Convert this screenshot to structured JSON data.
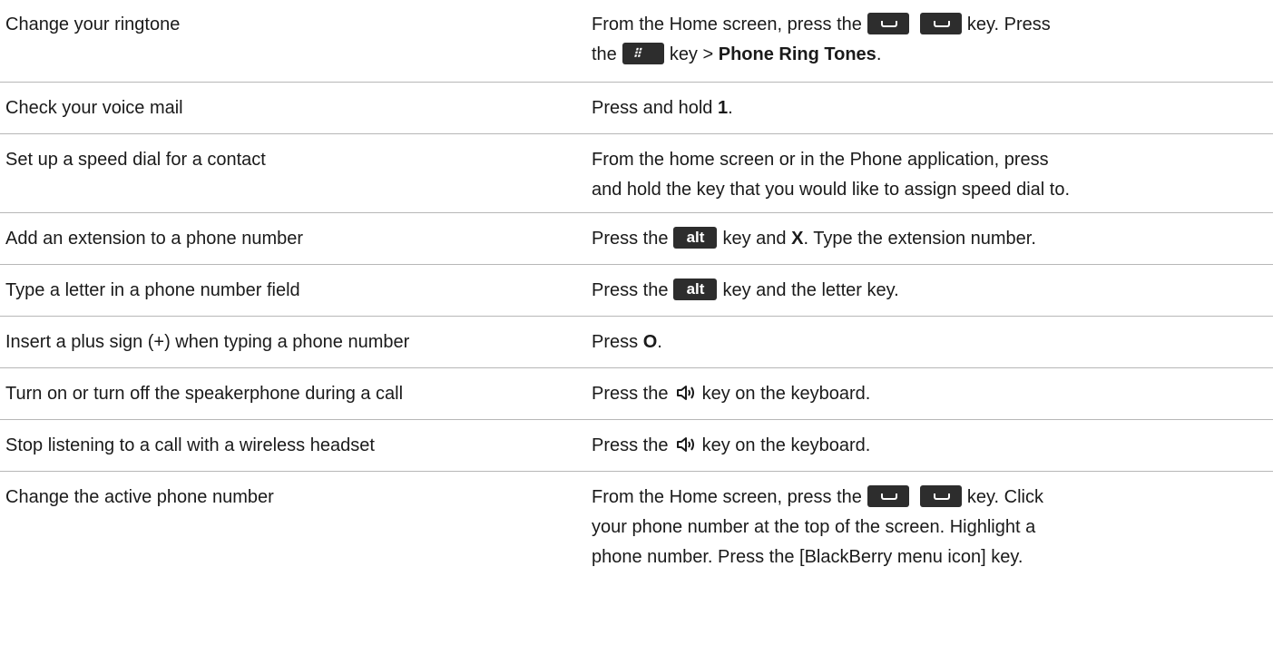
{
  "rows": [
    {
      "task": "Change your ringtone",
      "line1": {
        "a": "From the Home screen, press the",
        "b": "key. Press"
      },
      "line2": {
        "a": "the",
        "b": "key >",
        "bold": "Phone Ring Tones",
        "end": "."
      }
    },
    {
      "task": "Check your voice mail",
      "a": "Press and hold",
      "bold": "1",
      "end": "."
    },
    {
      "task": "Set up a speed dial for a contact",
      "line1": "From the home screen or in the Phone application, press",
      "line2": "and hold the key that you would like to assign speed dial to."
    },
    {
      "task": "Add an extension to a phone number",
      "a": "Press the",
      "key": "alt",
      "b": "key and",
      "bold": "X",
      "end": ". Type the extension number."
    },
    {
      "task": "Type a letter in a phone number field",
      "a": "Press the",
      "key": "alt",
      "b": "key and the letter key."
    },
    {
      "task": "Insert a plus sign (+) when typing a phone number",
      "a": "Press",
      "bold": "O",
      "end": "."
    },
    {
      "task": "Turn on or turn off the speakerphone during a call",
      "a": "Press the",
      "b": "key on the keyboard."
    },
    {
      "task": "Stop listening to a call with a wireless headset",
      "a": "Press the",
      "b": "key on the keyboard."
    },
    {
      "task": "Change the active phone number",
      "line1": {
        "a": "From the Home screen, press the",
        "b": "key. Click"
      },
      "line2": "your phone number at the top of the screen. Highlight a",
      "line3": "phone number. Press the [BlackBerry menu icon] key."
    }
  ],
  "icons": {
    "call_key": "send-key-icon",
    "menu_key": "blackberry-menu-key-icon",
    "speaker_key": "speakerphone-key-icon"
  }
}
